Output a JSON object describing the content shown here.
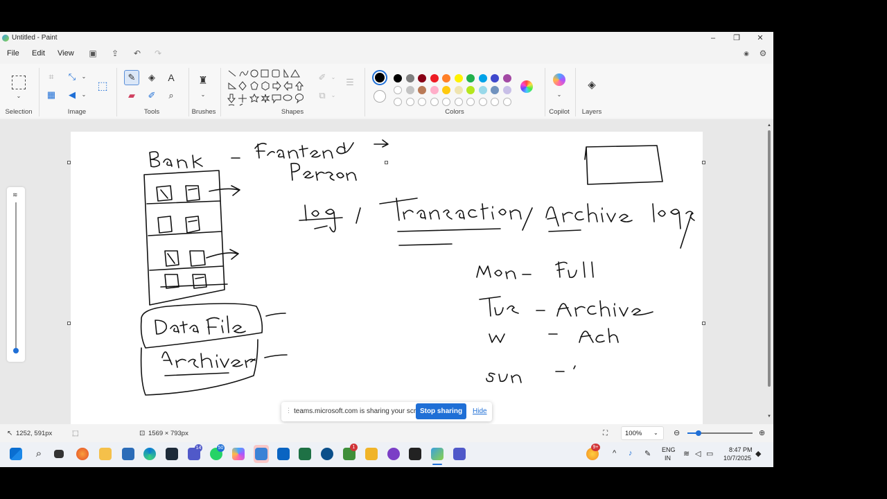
{
  "window": {
    "title": "Untitled - Paint"
  },
  "menu": {
    "file": "File",
    "edit": "Edit",
    "view": "View"
  },
  "ribbon": {
    "groups": {
      "selection": "Selection",
      "image": "Image",
      "tools": "Tools",
      "brushes": "Brushes",
      "shapes": "Shapes",
      "colors": "Colors",
      "copilot": "Copilot",
      "layers": "Layers"
    },
    "text_tool": "A",
    "colors_row1": [
      "#000000",
      "#7f7f7f",
      "#880015",
      "#ed1c24",
      "#ff7f27",
      "#fff200",
      "#22b14c",
      "#00a2e8",
      "#3f48cc",
      "#a349a4"
    ],
    "colors_row2": [
      "#ffffff",
      "#c3c3c3",
      "#b97a57",
      "#ffaec9",
      "#ffc90e",
      "#efe4b0",
      "#b5e61d",
      "#99d9ea",
      "#7092be",
      "#c8bfe7"
    ],
    "accent": "#1f6fd6"
  },
  "share_banner": {
    "text": "teams.microsoft.com is sharing your screen.",
    "stop": "Stop sharing",
    "hide": "Hide"
  },
  "status": {
    "cursor": "1252, 591px",
    "size": "1569 × 793px",
    "zoom": "100%"
  },
  "taskbar": {
    "badges": {
      "teams": "14",
      "whatsapp": "50",
      "notif": "1",
      "weather": "9+"
    },
    "lang1": "ENG",
    "lang2": "IN",
    "time": "8:47 PM",
    "date": "10/7/2025"
  }
}
